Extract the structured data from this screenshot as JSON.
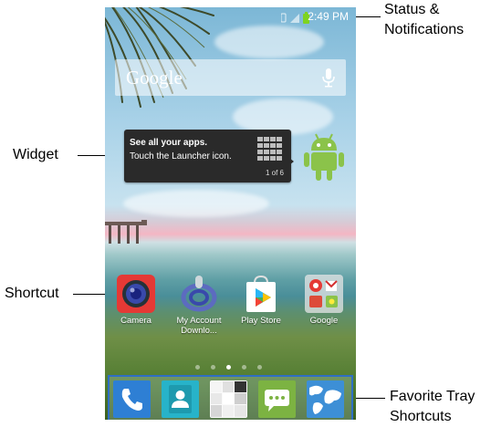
{
  "callouts": {
    "status_line1": "Status &",
    "status_line2": "Notifications",
    "widget": "Widget",
    "shortcut": "Shortcut",
    "tray_line1": "Favorite Tray",
    "tray_line2": "Shortcuts"
  },
  "statusbar": {
    "time": "2:49 PM"
  },
  "search": {
    "logo": "Google",
    "icon": "mic-icon"
  },
  "widget": {
    "title": "See all your apps.",
    "subtitle": "Touch the Launcher icon.",
    "page": "1 of 6",
    "icon": "grid-icon"
  },
  "apps": [
    {
      "label": "Camera",
      "icon": "camera-icon"
    },
    {
      "label": "My Account",
      "label2": "Downlo...",
      "icon": "my-account-icon"
    },
    {
      "label": "Play Store",
      "icon": "play-store-icon"
    },
    {
      "label": "Google",
      "icon": "google-folder-icon"
    }
  ],
  "page_indicator": {
    "count": 5,
    "active": 2
  },
  "tray": [
    {
      "icon": "phone-icon"
    },
    {
      "icon": "contacts-icon"
    },
    {
      "icon": "launcher-icon"
    },
    {
      "icon": "messaging-icon"
    },
    {
      "icon": "browser-icon"
    }
  ],
  "colors": {
    "tray_border": "#2f6fc4",
    "phone_blue": "#2e7fd4",
    "contacts_teal": "#27b3c9",
    "messaging_green": "#7cb342",
    "browser_blue": "#3d8fd6"
  }
}
